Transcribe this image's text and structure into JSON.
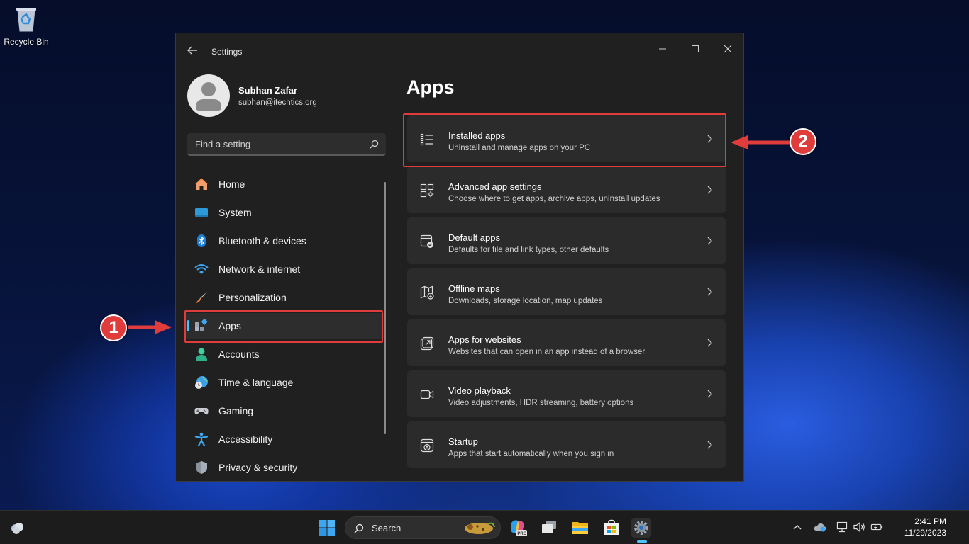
{
  "desktop": {
    "recycle_bin_label": "Recycle Bin"
  },
  "window": {
    "title": "Settings",
    "user": {
      "name": "Subhan Zafar",
      "email": "subhan@itechtics.org"
    },
    "search": {
      "placeholder": "Find a setting"
    },
    "nav": {
      "items": [
        {
          "label": "Home",
          "icon": "home-icon"
        },
        {
          "label": "System",
          "icon": "system-icon"
        },
        {
          "label": "Bluetooth & devices",
          "icon": "bluetooth-icon"
        },
        {
          "label": "Network & internet",
          "icon": "wifi-icon"
        },
        {
          "label": "Personalization",
          "icon": "brush-icon"
        },
        {
          "label": "Apps",
          "icon": "apps-icon",
          "active": true
        },
        {
          "label": "Accounts",
          "icon": "account-icon"
        },
        {
          "label": "Time & language",
          "icon": "clock-globe-icon"
        },
        {
          "label": "Gaming",
          "icon": "gamepad-icon"
        },
        {
          "label": "Accessibility",
          "icon": "accessibility-icon"
        },
        {
          "label": "Privacy & security",
          "icon": "shield-icon"
        }
      ]
    },
    "page": {
      "title": "Apps",
      "cards": [
        {
          "title": "Installed apps",
          "desc": "Uninstall and manage apps on your PC",
          "icon": "list-icon"
        },
        {
          "title": "Advanced app settings",
          "desc": "Choose where to get apps, archive apps, uninstall updates",
          "icon": "app-gear-icon"
        },
        {
          "title": "Default apps",
          "desc": "Defaults for file and link types, other defaults",
          "icon": "default-app-icon"
        },
        {
          "title": "Offline maps",
          "desc": "Downloads, storage location, map updates",
          "icon": "map-icon"
        },
        {
          "title": "Apps for websites",
          "desc": "Websites that can open in an app instead of a browser",
          "icon": "open-external-icon"
        },
        {
          "title": "Video playback",
          "desc": "Video adjustments, HDR streaming, battery options",
          "icon": "video-icon"
        },
        {
          "title": "Startup",
          "desc": "Apps that start automatically when you sign in",
          "icon": "startup-icon"
        }
      ]
    }
  },
  "annotations": {
    "step1": "1",
    "step2": "2",
    "color": "#e03c3c"
  },
  "taskbar": {
    "search_label": "Search",
    "copilot_badge": "PRE",
    "time": "2:41 PM",
    "date": "11/29/2023"
  },
  "colors": {
    "accent": "#4cc2ff",
    "window_bg": "#202020",
    "card_bg": "#2b2b2b"
  }
}
